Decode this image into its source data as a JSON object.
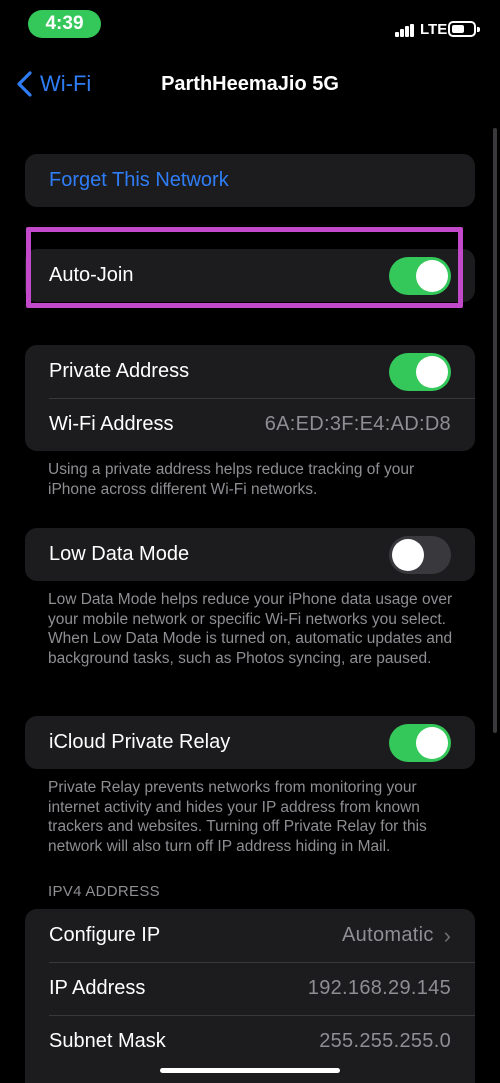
{
  "status_bar": {
    "time": "4:39",
    "carrier": "LTE",
    "time_pill_color": "#34c759"
  },
  "nav": {
    "back_label": "Wi-Fi",
    "title": "ParthHeemaJio 5G"
  },
  "forget_network": {
    "label": "Forget This Network"
  },
  "auto_join": {
    "label": "Auto-Join",
    "on": true
  },
  "private_address": {
    "label": "Private Address",
    "on": true,
    "wifi_address_label": "Wi-Fi Address",
    "wifi_address_value": "6A:ED:3F:E4:AD:D8",
    "footnote": "Using a private address helps reduce tracking of your iPhone across different Wi-Fi networks."
  },
  "low_data_mode": {
    "label": "Low Data Mode",
    "on": false,
    "footnote": "Low Data Mode helps reduce your iPhone data usage over your mobile network or specific Wi-Fi networks you select. When Low Data Mode is turned on, automatic updates and background tasks, such as Photos syncing, are paused."
  },
  "icloud_private_relay": {
    "label": "iCloud Private Relay",
    "on": true,
    "footnote": "Private Relay prevents networks from monitoring your internet activity and hides your IP address from known trackers and websites. Turning off Private Relay for this network will also turn off IP address hiding in Mail."
  },
  "ipv4": {
    "header": "IPV4 ADDRESS",
    "configure_ip_label": "Configure IP",
    "configure_ip_value": "Automatic",
    "ip_address_label": "IP Address",
    "ip_address_value": "192.168.29.145",
    "subnet_mask_label": "Subnet Mask",
    "subnet_mask_value": "255.255.255.0"
  },
  "colors": {
    "accent": "#2f7df6",
    "toggle_on": "#34c759",
    "highlight": "#c249c9"
  }
}
